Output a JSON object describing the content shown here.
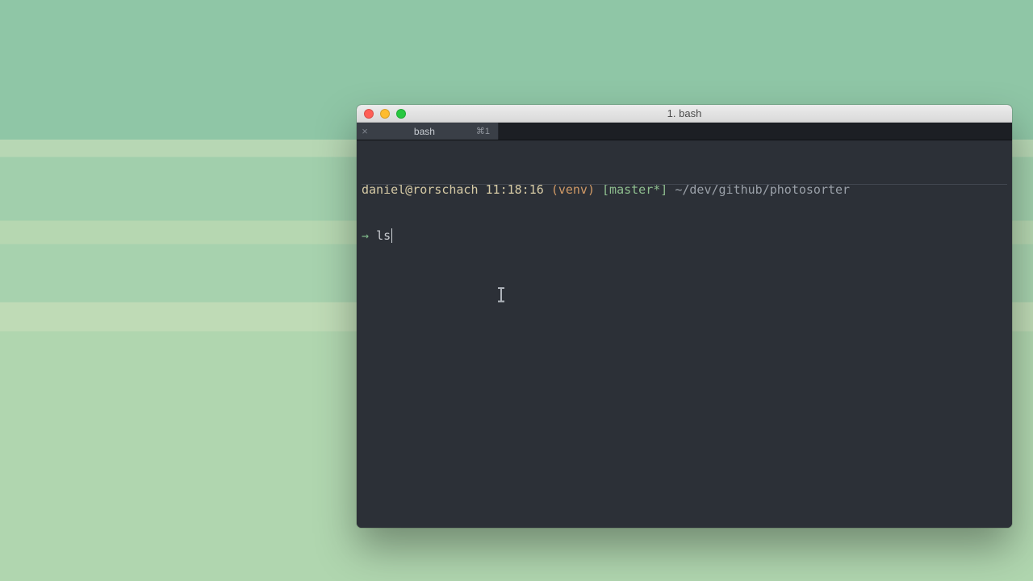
{
  "window": {
    "title": "1. bash"
  },
  "tabs": [
    {
      "label": "bash",
      "shortcut": "⌘1",
      "close_glyph": "×"
    }
  ],
  "prompt": {
    "user_host": "daniel@rorschach",
    "time": "11:18:16",
    "venv": "(venv)",
    "branch": "[master*]",
    "path": "~/dev/github/photosorter",
    "arrow": "→",
    "command": "ls"
  }
}
